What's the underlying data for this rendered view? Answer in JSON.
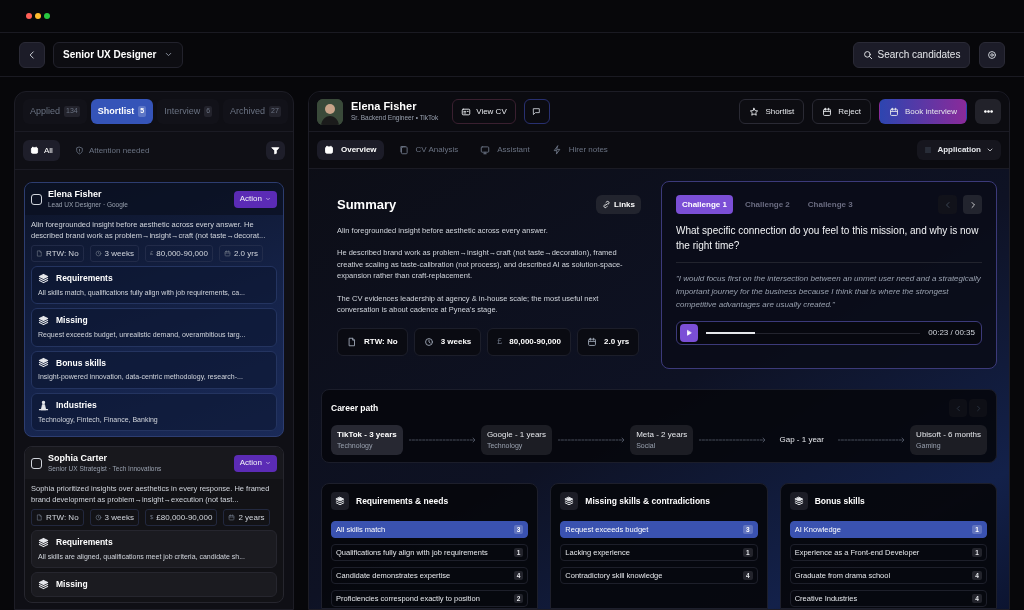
{
  "window": {
    "controls": [
      {
        "color": "#ff5f57"
      },
      {
        "color": "#febc2e"
      },
      {
        "color": "#28c840"
      }
    ]
  },
  "header": {
    "job_title": "Senior UX Designer",
    "search": "Search candidates"
  },
  "pipeline_tabs": [
    {
      "label": "Applied",
      "count": "134",
      "selected": false
    },
    {
      "label": "Shortlist",
      "count": "5",
      "selected": true
    },
    {
      "label": "Interview",
      "count": "6",
      "selected": false
    },
    {
      "label": "Archived",
      "count": "27",
      "selected": false
    }
  ],
  "filters": [
    {
      "label": "All",
      "selected": true
    },
    {
      "label": "Attention needed",
      "selected": false
    }
  ],
  "candidates": [
    {
      "name": "Elena Fisher",
      "role": "Lead UX Designer · Google",
      "checked": false,
      "highlighted": true,
      "action": "Action",
      "summary": "Alin foregrounded insight before aesthetic across every answer. He described brand work as problem→insight→craft (not taste→decorat...",
      "facts": [
        {
          "kind": "rtw",
          "label": "RTW: No"
        },
        {
          "kind": "notice",
          "label": "3 weeks"
        },
        {
          "kind": "salary",
          "symbol": "£",
          "label": "80,000-90,000"
        },
        {
          "kind": "experience",
          "label": "2.0 yrs"
        }
      ],
      "sections": [
        {
          "kind": "requirements",
          "title": "Requirements",
          "text": "All skills match, qualifications fully align with job requirements, ca..."
        },
        {
          "kind": "missing",
          "title": "Missing",
          "text": "Request exceeds budget, unrealistic demand, overambitious targ..."
        },
        {
          "kind": "bonus",
          "title": "Bonus skills",
          "text": "Insight-powered innovation, data-centric methodology, research-..."
        },
        {
          "kind": "industries",
          "title": "Industries",
          "text": "Technology, Fintech, Finance, Banking"
        }
      ]
    },
    {
      "name": "Sophia Carter",
      "role": "Senior UX Strategist · Tech Innovations",
      "checked": false,
      "highlighted": false,
      "action": "Action",
      "summary": "Sophia prioritized insights over aesthetics in every response. He framed brand development as problem→insight→execution (not tast...",
      "facts": [
        {
          "kind": "rtw",
          "label": "RTW: No"
        },
        {
          "kind": "notice",
          "label": "3 weeks"
        },
        {
          "kind": "salary",
          "symbol": "$",
          "label": "£80,000-90,000"
        },
        {
          "kind": "experience",
          "label": "2 years"
        }
      ],
      "sections": [
        {
          "kind": "requirements",
          "title": "Requirements",
          "text": "All skills are aligned, qualifications meet job criteria, candidate sh..."
        },
        {
          "kind": "missing",
          "title": "Missing"
        }
      ]
    }
  ],
  "profile": {
    "name": "Elena Fisher",
    "role": "Sr. Backend Engineer • TikTok",
    "view_cv": "View CV",
    "actions": [
      {
        "kind": "shortlist",
        "label": "Shortlist"
      },
      {
        "kind": "reject",
        "label": "Reject"
      },
      {
        "kind": "book",
        "label": "Book interview"
      }
    ],
    "tabs": [
      {
        "kind": "overview",
        "label": "Overview",
        "selected": true
      },
      {
        "kind": "cv",
        "label": "CV Analysis",
        "selected": false
      },
      {
        "kind": "assistant",
        "label": "Assistant",
        "selected": false
      },
      {
        "kind": "notes",
        "label": "Hirer notes",
        "selected": false
      }
    ],
    "view_select": "Application"
  },
  "summary": {
    "title": "Summary",
    "links": "Links",
    "paragraphs": [
      "Alin foregrounded insight before aesthetic across every answer.",
      "He described brand work as problem→insight→craft (not taste→decoration), framed creative scaling as taste-calibration (not process), and described AI as solution-space-expansion rather than craft-replacement.",
      "The CV evidences leadership at agency & in-house scale; the most useful next conversation is about cadence at Pynea's stage."
    ],
    "facts": [
      {
        "kind": "rtw",
        "label": "RTW: No"
      },
      {
        "kind": "notice",
        "label": "3 weeks"
      },
      {
        "kind": "salary",
        "symbol": "£",
        "label": "80,000-90,000"
      },
      {
        "kind": "experience",
        "label": "2.0 yrs"
      }
    ]
  },
  "challenges": {
    "tabs": [
      {
        "label": "Challenge 1",
        "selected": true
      },
      {
        "label": "Challenge 2",
        "selected": false
      },
      {
        "label": "Challenge 3",
        "selected": false
      }
    ],
    "question": "What specific connection do you feel to this mission, and why is now the right time?",
    "answer": "\"I would focus first on the intersection between an unmet user need and a strategically important journey for the business because I think that is where the strongest competitive advantages are usually created.\"",
    "audio": {
      "level": 0.23,
      "time": "00:23 / 00:35"
    }
  },
  "career_path": {
    "title": "Career path",
    "steps": [
      {
        "kind": "job",
        "label": "TikTok - 3 years",
        "sub": "Technology",
        "selected": true
      },
      {
        "kind": "job",
        "label": "Google - 1 years",
        "sub": "Technology",
        "selected": false
      },
      {
        "kind": "job",
        "label": "Meta - 2 years",
        "sub": "Social",
        "selected": false
      },
      {
        "kind": "gap",
        "label": "Gap - 1 year"
      },
      {
        "kind": "job",
        "label": "Ubisoft - 6 months",
        "sub": "Gaming",
        "selected": false
      }
    ]
  },
  "skill_cards": [
    {
      "title": "Requirements & needs",
      "items": [
        {
          "label": "All skills match",
          "count": "3",
          "selected": true
        },
        {
          "label": "Qualifications fully align with job requirements",
          "count": "1",
          "selected": false
        },
        {
          "label": "Candidate demonstrates expertise",
          "count": "4",
          "selected": false
        },
        {
          "label": "Proficiencies correspond exactly to position",
          "count": "2",
          "selected": false
        }
      ]
    },
    {
      "title": "Missing skills & contradictions",
      "items": [
        {
          "label": "Request exceeds budget",
          "count": "3",
          "selected": true
        },
        {
          "label": "Lacking experience",
          "count": "1",
          "selected": false
        },
        {
          "label": "Contradictory skill knowledge",
          "count": "4",
          "selected": false
        }
      ]
    },
    {
      "title": "Bonus skills",
      "items": [
        {
          "label": "AI Knowledge",
          "count": "1",
          "selected": true
        },
        {
          "label": "Experience as a Front-end Developer",
          "count": "1",
          "selected": false
        },
        {
          "label": "Graduate from drama school",
          "count": "4",
          "selected": false
        },
        {
          "label": "Creative Industries",
          "count": "4",
          "selected": false
        }
      ]
    }
  ]
}
